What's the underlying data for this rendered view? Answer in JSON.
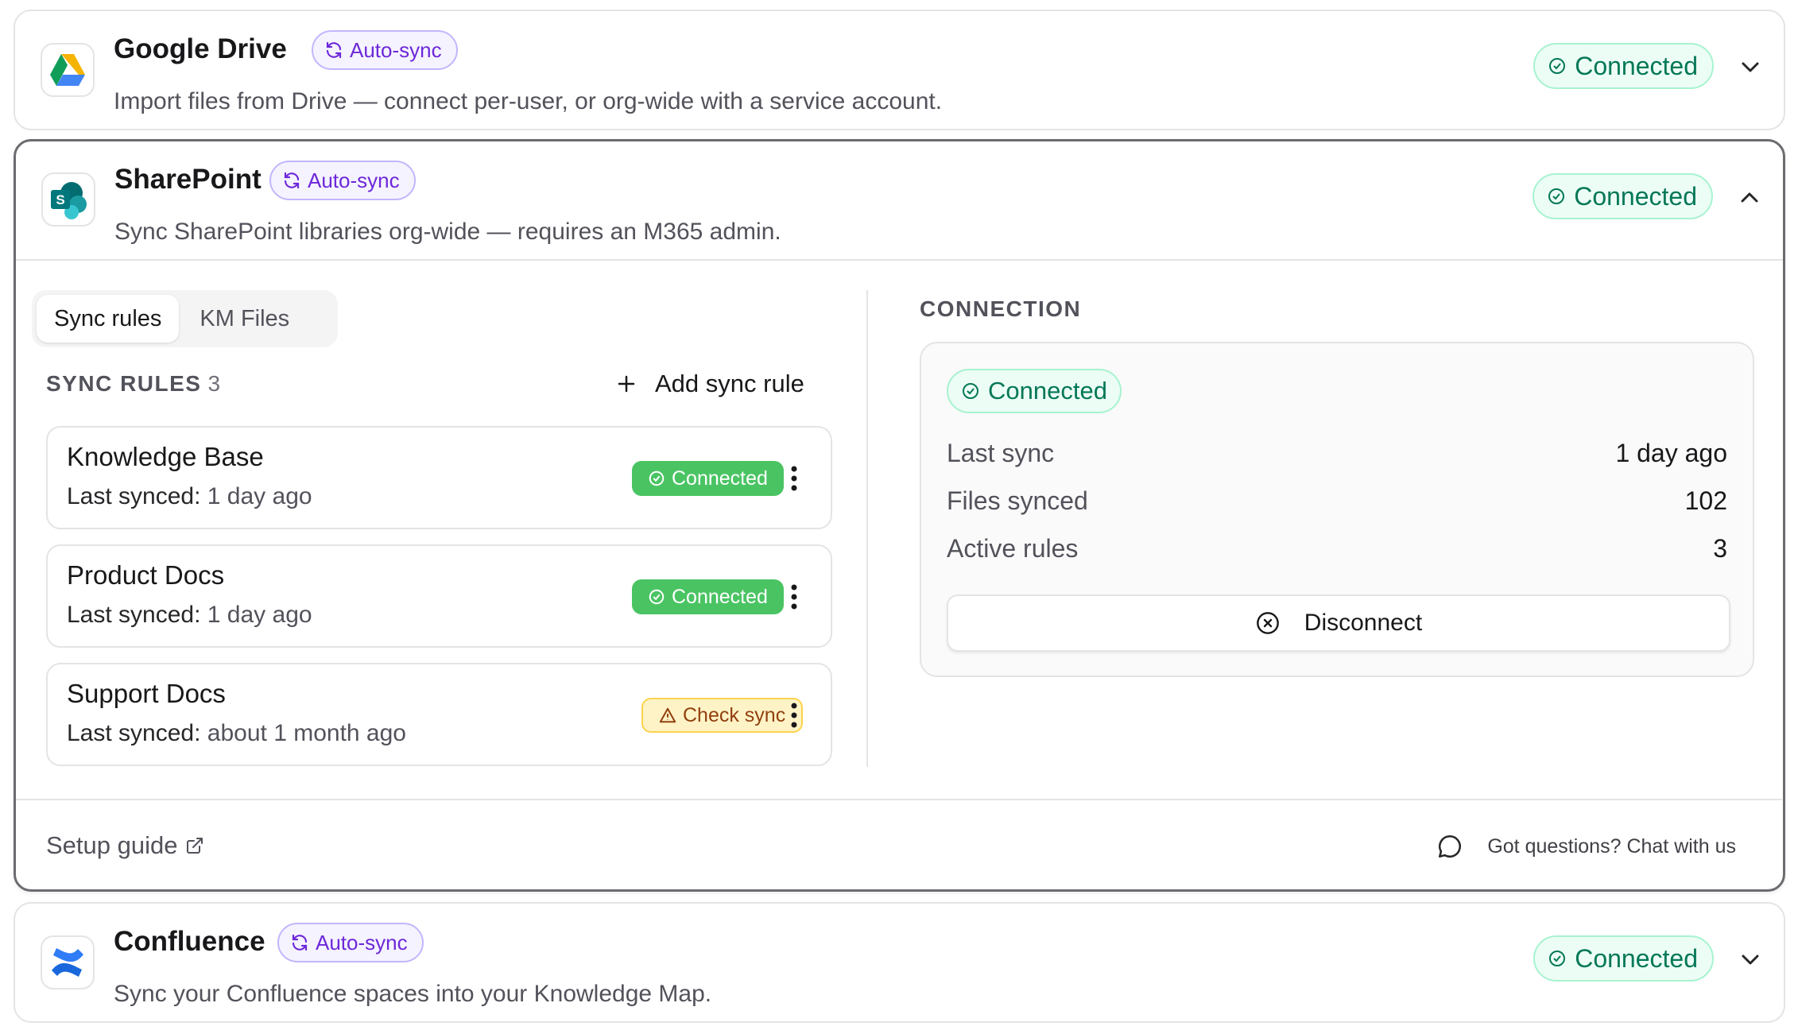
{
  "integrations": {
    "google_drive": {
      "title": "Google Drive",
      "badge": "Auto-sync",
      "description": "Import files from Drive — connect per-user, or org-wide with a service account.",
      "status": "Connected",
      "icon": "google-drive-logo"
    },
    "sharepoint": {
      "title": "SharePoint",
      "badge": "Auto-sync",
      "description": "Sync SharePoint libraries org-wide — requires an M365 admin.",
      "status": "Connected",
      "icon": "sharepoint-logo"
    },
    "confluence": {
      "title": "Confluence",
      "badge": "Auto-sync",
      "description": "Sync your Confluence spaces into your Knowledge Map.",
      "status": "Connected",
      "icon": "confluence-logo"
    }
  },
  "tabs": [
    {
      "label": "Sync rules",
      "active": true
    },
    {
      "label": "KM Files",
      "active": false
    }
  ],
  "sync_rules": {
    "heading": "SYNC RULES",
    "count": "3",
    "add_label": "Add sync rule",
    "items": [
      {
        "name": "Knowledge Base",
        "sub_label": "Last synced:",
        "sub_value": "1 day ago",
        "status": "Connected",
        "state": "ok"
      },
      {
        "name": "Product Docs",
        "sub_label": "Last synced:",
        "sub_value": "1 day ago",
        "status": "Connected",
        "state": "ok"
      },
      {
        "name": "Support Docs",
        "sub_label": "Last synced:",
        "sub_value": "about 1 month ago",
        "status": "Check sync",
        "state": "warn"
      }
    ]
  },
  "connection": {
    "heading": "CONNECTION",
    "status": "Connected",
    "rows": [
      {
        "label": "Last sync",
        "value": "1 day ago"
      },
      {
        "label": "Files synced",
        "value": "102"
      },
      {
        "label": "Active rules",
        "value": "3"
      }
    ],
    "disconnect_label": "Disconnect"
  },
  "footer": {
    "setup_guide": "Setup guide",
    "chat": "Got questions? Chat with us"
  },
  "colors": {
    "accent_purple": "#6d28d9",
    "connected_green": "#047857",
    "badge_green": "#4ac463",
    "warn_amber": "#92400e"
  }
}
